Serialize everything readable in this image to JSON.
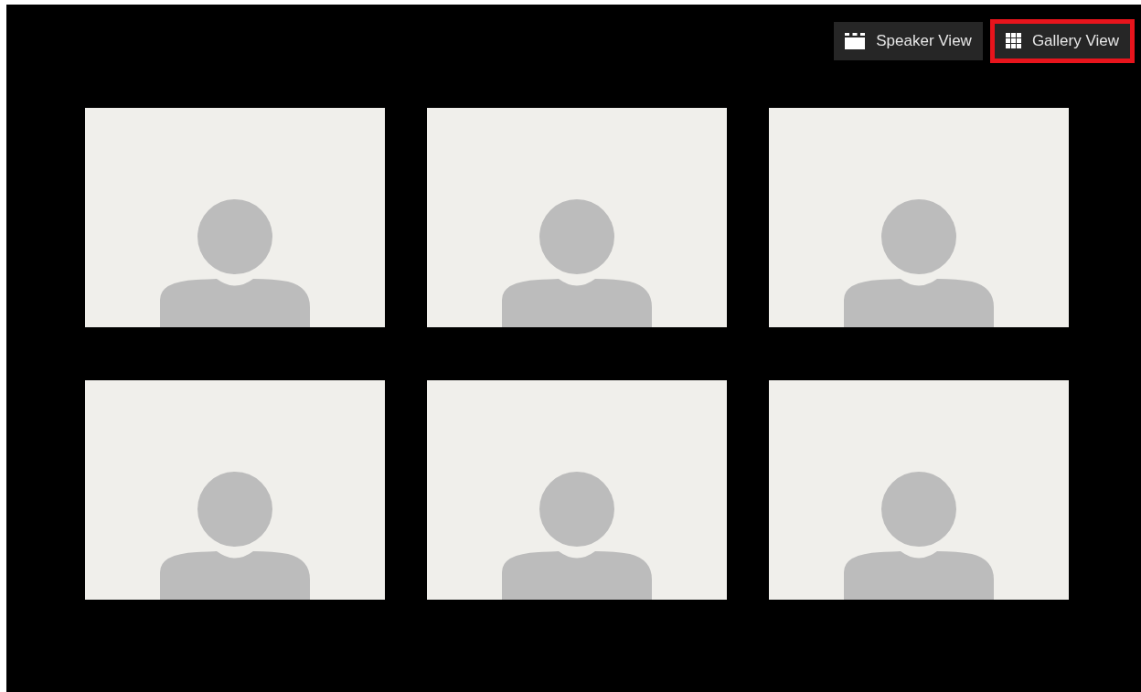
{
  "view_buttons": [
    {
      "label": "Speaker View",
      "kind": "speaker",
      "selected": false
    },
    {
      "label": "Gallery View",
      "kind": "gallery",
      "selected": true
    }
  ],
  "video_tiles": [
    {
      "kind": "avatar"
    },
    {
      "kind": "avatar"
    },
    {
      "kind": "avatar"
    },
    {
      "kind": "avatar"
    },
    {
      "kind": "avatar"
    },
    {
      "kind": "avatar"
    }
  ]
}
